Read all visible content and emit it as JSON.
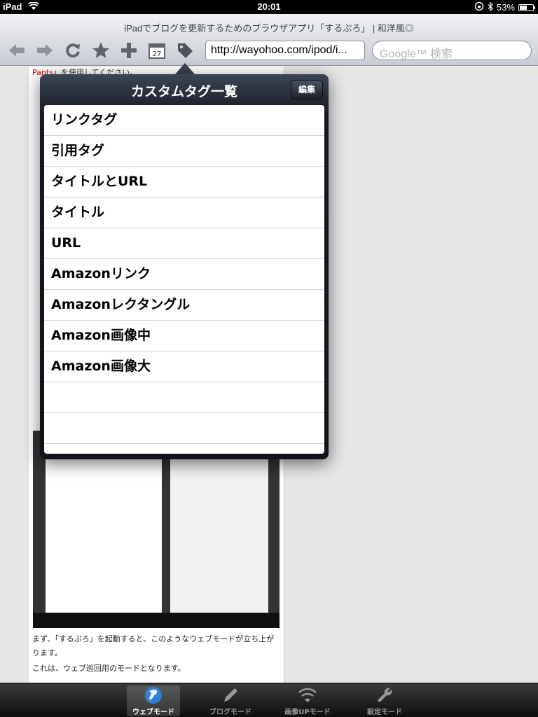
{
  "status": {
    "carrier": "iPad",
    "time": "20:01",
    "battery": "53%",
    "battery_level": 0.53
  },
  "toolbar": {
    "page_title": "iPadでブログを更新するためのブラウザアプリ「するぷろ」 | 和洋風◎",
    "url": "http://wayohoo.com/ipod/i...",
    "search_placeholder": "Google™ 検索",
    "buttons": [
      "back-icon",
      "forward-icon",
      "reload-icon",
      "star-icon",
      "add-icon",
      "calendar-icon",
      "tag-icon"
    ],
    "calendar_day": "27"
  },
  "web": {
    "top_text": "」を使用してください。",
    "top_text_link": "Pants",
    "para1": "まず、「するぷろ」を起動すると、このようなウェブモードが立ち上がります。",
    "para2": "これは、ウェブ巡回用のモードとなります。"
  },
  "popover": {
    "title": "カスタムタグ一覧",
    "edit_label": "編集",
    "items": [
      "リンクタグ",
      "引用タグ",
      "タイトルとURL",
      "タイトル",
      "URL",
      "Amazonリンク",
      "Amazonレクタングル",
      "Amazon画像中",
      "Amazon画像大"
    ]
  },
  "tabbar": {
    "tabs": [
      {
        "label": "ウェブモード",
        "icon": "globe-icon"
      },
      {
        "label": "ブログモード",
        "icon": "pencil-icon"
      },
      {
        "label": "画像UPモード",
        "icon": "wifi-icon"
      },
      {
        "label": "設定モード",
        "icon": "wrench-icon"
      }
    ]
  }
}
